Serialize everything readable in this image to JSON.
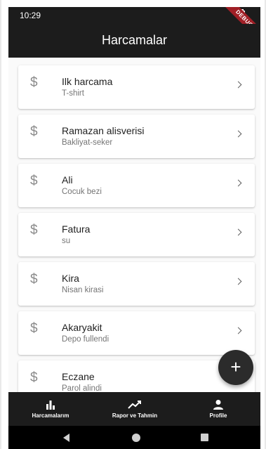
{
  "status_bar": {
    "time": "10:29",
    "debug_label": "DEBUG"
  },
  "app_bar": {
    "title": "Harcamalar"
  },
  "expenses": [
    {
      "icon": "dollar-icon",
      "symbol": "$",
      "title": "Ilk harcama",
      "subtitle": "T-shirt"
    },
    {
      "icon": "dollar-icon",
      "symbol": "$",
      "title": "Ramazan alisverisi",
      "subtitle": "Bakliyat-seker"
    },
    {
      "icon": "dollar-icon",
      "symbol": "$",
      "title": "Ali",
      "subtitle": "Cocuk bezi"
    },
    {
      "icon": "dollar-icon",
      "symbol": "$",
      "title": "Fatura",
      "subtitle": "su"
    },
    {
      "icon": "dollar-icon",
      "symbol": "$",
      "title": "Kira",
      "subtitle": "Nisan kirasi"
    },
    {
      "icon": "dollar-icon",
      "symbol": "$",
      "title": "Akaryakit",
      "subtitle": "Depo fullendi"
    },
    {
      "icon": "dollar-icon",
      "symbol": "$",
      "title": "Eczane",
      "subtitle": "Parol alindi"
    }
  ],
  "fab": {
    "icon": "plus-icon",
    "symbol": "+"
  },
  "bottom_nav": {
    "items": [
      {
        "icon": "bar-chart-icon",
        "label": "Harcamalarım"
      },
      {
        "icon": "trending-up-icon",
        "label": "Rapor ve Tahmin"
      },
      {
        "icon": "person-icon",
        "label": "Profile"
      }
    ]
  },
  "colors": {
    "bar_background": "#1c1c1c",
    "list_background": "#fafafa",
    "card_background": "#ffffff",
    "debug_ribbon": "#a01f26"
  }
}
